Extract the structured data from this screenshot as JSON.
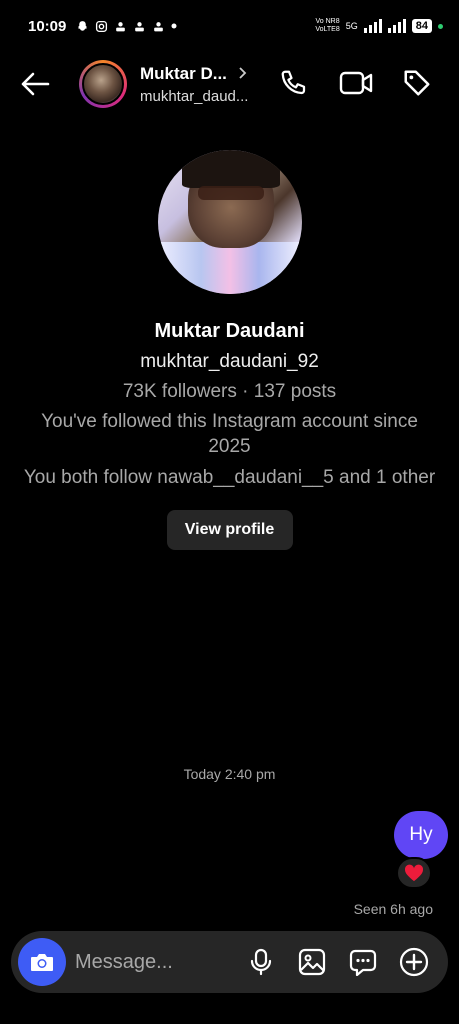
{
  "status_bar": {
    "time": "10:09",
    "net_top": "Vo NR8",
    "net_bottom": "VoLTE8",
    "net_type": "5G",
    "battery": "84"
  },
  "header": {
    "name": "Muktar D...",
    "username": "mukhtar_daud..."
  },
  "profile": {
    "name": "Muktar Daudani",
    "username": "mukhtar_daudani_92",
    "stats": "73K followers · 137 posts",
    "followed_since": "You've followed this Instagram account since 2025",
    "mutuals": "You both follow nawab__daudani__5 and 1 other",
    "view_profile_label": "View profile"
  },
  "chat": {
    "timestamp": "Today 2:40 pm",
    "messages": [
      {
        "text": "Hy",
        "sender": "me",
        "reaction": "heart"
      }
    ],
    "seen": "Seen 6h ago"
  },
  "composer": {
    "placeholder": "Message..."
  },
  "colors": {
    "background": "#000000",
    "bubble": "#6046f5",
    "camera": "#3e5cf5",
    "surface": "#262626",
    "muted_text": "#a8a8a8",
    "heart": "#ed1c3b"
  },
  "icons": {
    "back": "arrow-left-icon",
    "call": "phone-icon",
    "video": "video-camera-icon",
    "tag": "tag-icon",
    "camera": "camera-icon",
    "mic": "microphone-icon",
    "gallery": "image-icon",
    "sticker": "chat-bubble-icon",
    "add": "plus-circle-icon"
  }
}
